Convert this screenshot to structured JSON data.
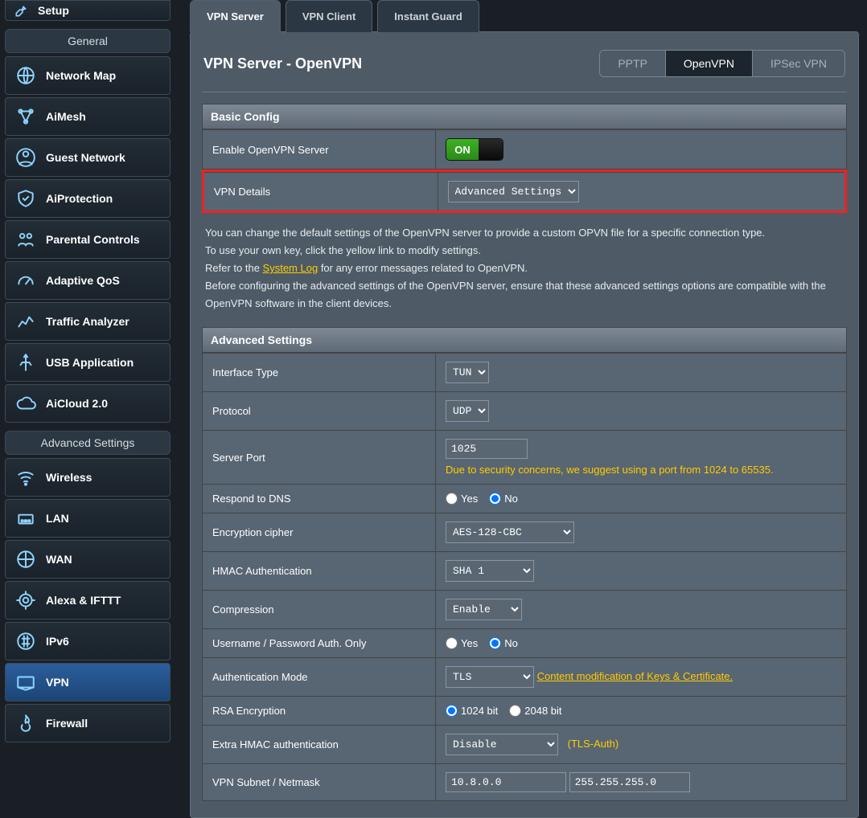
{
  "sidebar": {
    "setup_label": "Setup",
    "general_header": "General",
    "general": [
      {
        "label": "Network Map",
        "icon": "globe"
      },
      {
        "label": "AiMesh",
        "icon": "mesh"
      },
      {
        "label": "Guest Network",
        "icon": "guest"
      },
      {
        "label": "AiProtection",
        "icon": "shield"
      },
      {
        "label": "Parental Controls",
        "icon": "family"
      },
      {
        "label": "Adaptive QoS",
        "icon": "gauge"
      },
      {
        "label": "Traffic Analyzer",
        "icon": "traffic"
      },
      {
        "label": "USB Application",
        "icon": "usb"
      },
      {
        "label": "AiCloud 2.0",
        "icon": "cloud"
      }
    ],
    "advanced_header": "Advanced Settings",
    "advanced": [
      {
        "label": "Wireless",
        "icon": "wifi"
      },
      {
        "label": "LAN",
        "icon": "lan"
      },
      {
        "label": "WAN",
        "icon": "wan"
      },
      {
        "label": "Alexa & IFTTT",
        "icon": "alexa"
      },
      {
        "label": "IPv6",
        "icon": "ipv6"
      },
      {
        "label": "VPN",
        "icon": "vpn",
        "active": true
      },
      {
        "label": "Firewall",
        "icon": "fire"
      }
    ]
  },
  "tabs": [
    "VPN Server",
    "VPN Client",
    "Instant Guard"
  ],
  "active_tab": 0,
  "page_title": "VPN Server - OpenVPN",
  "pills": [
    "PPTP",
    "OpenVPN",
    "IPSec VPN"
  ],
  "active_pill": 1,
  "basic": {
    "header": "Basic Config",
    "enable_label": "Enable OpenVPN Server",
    "enable_value": "ON",
    "details_label": "VPN Details",
    "details_value": "Advanced Settings"
  },
  "info_text": {
    "l1": "You can change the default settings of the OpenVPN server to provide a custom OPVN file for a specific connection type.",
    "l2": "To use your own key, click the yellow link to modify settings.",
    "l3a": "Refer to the ",
    "l3_link": "System Log",
    "l3b": " for any error messages related to OpenVPN.",
    "l4": "Before configuring the advanced settings of the OpenVPN server, ensure that these advanced settings options are compatible with the OpenVPN software in the client devices."
  },
  "advanced": {
    "header": "Advanced Settings",
    "rows": {
      "interface_type": {
        "label": "Interface Type",
        "value": "TUN"
      },
      "protocol": {
        "label": "Protocol",
        "value": "UDP"
      },
      "server_port": {
        "label": "Server Port",
        "value": "1025",
        "note": "Due to security concerns, we suggest using a port from 1024 to 65535."
      },
      "respond_dns": {
        "label": "Respond to DNS",
        "yes": "Yes",
        "no": "No",
        "value": "No"
      },
      "cipher": {
        "label": "Encryption cipher",
        "value": "AES-128-CBC"
      },
      "hmac": {
        "label": "HMAC Authentication",
        "value": "SHA 1"
      },
      "compression": {
        "label": "Compression",
        "value": "Enable"
      },
      "userpass": {
        "label": "Username / Password Auth. Only",
        "yes": "Yes",
        "no": "No",
        "value": "No"
      },
      "auth_mode": {
        "label": "Authentication Mode",
        "value": "TLS",
        "link": "Content modification of Keys & Certificate."
      },
      "rsa": {
        "label": "RSA Encryption",
        "opt1": "1024 bit",
        "opt2": "2048 bit",
        "value": "1024 bit"
      },
      "extra_hmac": {
        "label": "Extra HMAC authentication",
        "value": "Disable",
        "hint": "(TLS-Auth)"
      },
      "subnet": {
        "label": "VPN Subnet / Netmask",
        "v1": "10.8.0.0",
        "v2": "255.255.255.0"
      }
    }
  }
}
